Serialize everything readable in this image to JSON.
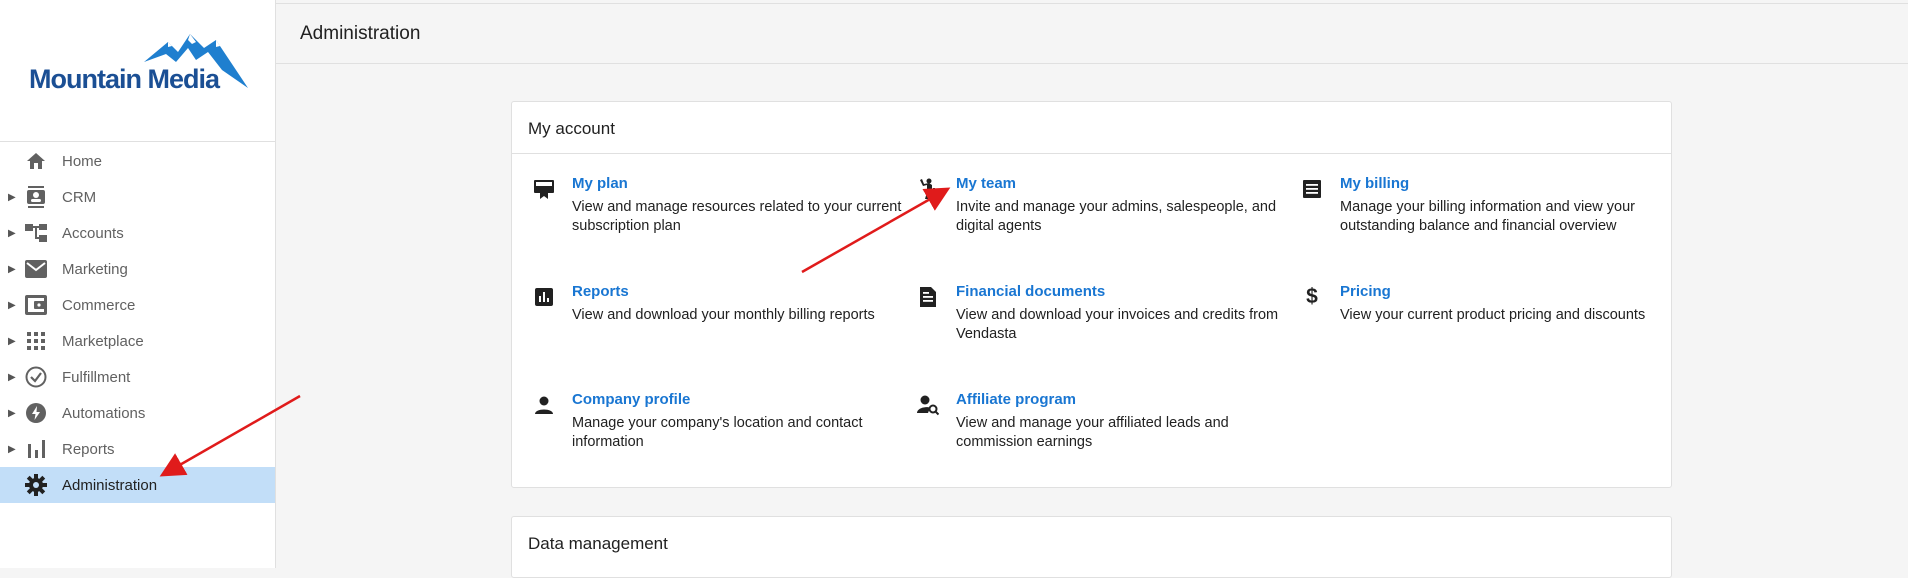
{
  "brand": {
    "name": "Mountain Media",
    "accent": "#1b4f94"
  },
  "sidebar": {
    "items": [
      {
        "label": "Home",
        "icon": "home-icon",
        "expandable": false,
        "active": false
      },
      {
        "label": "CRM",
        "icon": "contact-card-icon",
        "expandable": true,
        "active": false
      },
      {
        "label": "Accounts",
        "icon": "hierarchy-icon",
        "expandable": true,
        "active": false
      },
      {
        "label": "Marketing",
        "icon": "mail-icon",
        "expandable": true,
        "active": false
      },
      {
        "label": "Commerce",
        "icon": "wallet-icon",
        "expandable": true,
        "active": false
      },
      {
        "label": "Marketplace",
        "icon": "apps-grid-icon",
        "expandable": true,
        "active": false
      },
      {
        "label": "Fulfillment",
        "icon": "check-circle-icon",
        "expandable": true,
        "active": false
      },
      {
        "label": "Automations",
        "icon": "bolt-circle-icon",
        "expandable": true,
        "active": false
      },
      {
        "label": "Reports",
        "icon": "bar-chart-icon",
        "expandable": true,
        "active": false
      },
      {
        "label": "Administration",
        "icon": "gear-icon",
        "expandable": false,
        "active": true
      }
    ]
  },
  "header": {
    "title": "Administration"
  },
  "my_account": {
    "title": "My account",
    "tiles": [
      {
        "title": "My plan",
        "desc": "View and manage resources related to your current subscription plan",
        "icon": "plan-icon"
      },
      {
        "title": "My team",
        "desc": "Invite and manage your admins, salespeople, and digital agents",
        "icon": "team-icon"
      },
      {
        "title": "My billing",
        "desc": "Manage your billing information and view your outstanding balance and financial overview",
        "icon": "billing-icon"
      },
      {
        "title": "Reports",
        "desc": "View and download your monthly billing reports",
        "icon": "report-icon"
      },
      {
        "title": "Financial documents",
        "desc": "View and download your invoices and credits from Vendasta",
        "icon": "document-icon"
      },
      {
        "title": "Pricing",
        "desc": "View your current product pricing and discounts",
        "icon": "dollar-icon"
      },
      {
        "title": "Company profile",
        "desc": "Manage your company's location and contact information",
        "icon": "person-icon"
      },
      {
        "title": "Affiliate program",
        "desc": "View and manage your affiliated leads and commission earnings",
        "icon": "person-search-icon"
      }
    ]
  },
  "data_management": {
    "title": "Data management"
  },
  "colors": {
    "link": "#1976d2",
    "active_nav": "#c2def8",
    "annotation_arrow": "#e01b1b"
  }
}
